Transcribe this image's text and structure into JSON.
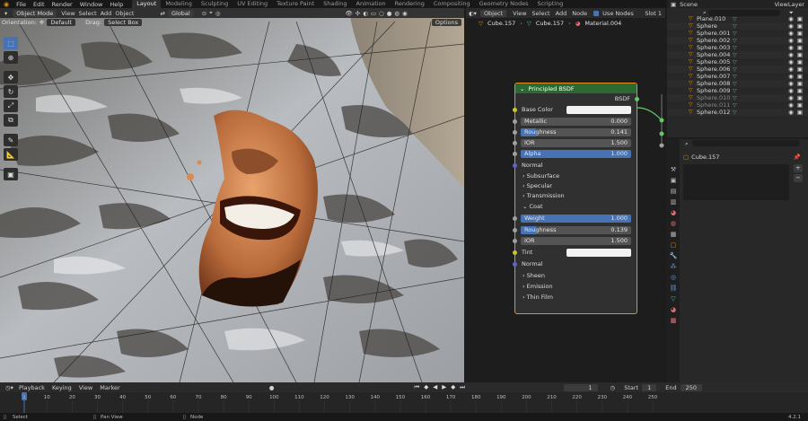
{
  "menu": [
    "File",
    "Edit",
    "Render",
    "Window",
    "Help"
  ],
  "workspaces": [
    "Layout",
    "Modeling",
    "Sculpting",
    "UV Editing",
    "Texture Paint",
    "Shading",
    "Animation",
    "Rendering",
    "Compositing",
    "Geometry Nodes",
    "Scripting"
  ],
  "active_workspace": "Layout",
  "scene": {
    "name": "Scene",
    "view_layer": "ViewLayer"
  },
  "viewport": {
    "mode": "Object Mode",
    "menus": [
      "View",
      "Select",
      "Add",
      "Object"
    ],
    "transform": "Global",
    "orientation_label": "Orientation:",
    "orientation": "Default",
    "drag_label": "Drag:",
    "drag": "Select Box",
    "options": "Options"
  },
  "node_editor": {
    "type": "Object",
    "menus": [
      "View",
      "Select",
      "Add",
      "Node"
    ],
    "use_nodes": "Use Nodes",
    "slot": "Slot 1",
    "crumbs": [
      "Cube.157",
      "Cube.157",
      "Material.004"
    ]
  },
  "bsdf": {
    "title": "Principled BSDF",
    "output": "BSDF",
    "base_color": "Base Color",
    "metallic": {
      "label": "Metallic",
      "value": "0.000",
      "fraction": 0.0
    },
    "roughness": {
      "label": "Roughness",
      "value": "0.141",
      "fraction": 0.141
    },
    "ior": {
      "label": "IOR",
      "value": "1.500"
    },
    "alpha": {
      "label": "Alpha",
      "value": "1.000",
      "fraction": 1.0
    },
    "normal": "Normal",
    "panels_a": [
      "Subsurface",
      "Specular",
      "Transmission"
    ],
    "coat": "Coat",
    "coat_weight": {
      "label": "Weight",
      "value": "1.000",
      "fraction": 1.0
    },
    "coat_roughness": {
      "label": "Roughness",
      "value": "0.139",
      "fraction": 0.139
    },
    "coat_ior": {
      "label": "IOR",
      "value": "1.500"
    },
    "tint": "Tint",
    "coat_normal": "Normal",
    "panels_b": [
      "Sheen",
      "Emission",
      "Thin Film"
    ]
  },
  "outliner": {
    "search_placeholder": "",
    "items": [
      "Plane.010",
      "Sphere",
      "Sphere.001",
      "Sphere.002",
      "Sphere.003",
      "Sphere.004",
      "Sphere.005",
      "Sphere.006",
      "Sphere.007",
      "Sphere.008",
      "Sphere.009",
      "Sphere.010",
      "Sphere.011",
      "Sphere.012"
    ]
  },
  "properties": {
    "object": "Cube.157",
    "search_placeholder": ""
  },
  "timeline": {
    "menus": [
      "Playback",
      "Keying",
      "View",
      "Marker"
    ],
    "current_frame": "1",
    "start_label": "Start",
    "start": "1",
    "end_label": "End",
    "end": "250",
    "ticks": [
      "1",
      "10",
      "20",
      "30",
      "40",
      "50",
      "60",
      "70",
      "80",
      "90",
      "100",
      "110",
      "120",
      "130",
      "140",
      "150",
      "160",
      "170",
      "180",
      "190",
      "200",
      "210",
      "220",
      "230",
      "240",
      "250"
    ]
  },
  "status": {
    "select": "Select",
    "pan": "Pan View",
    "node": "Node",
    "version": "4.2.1"
  }
}
